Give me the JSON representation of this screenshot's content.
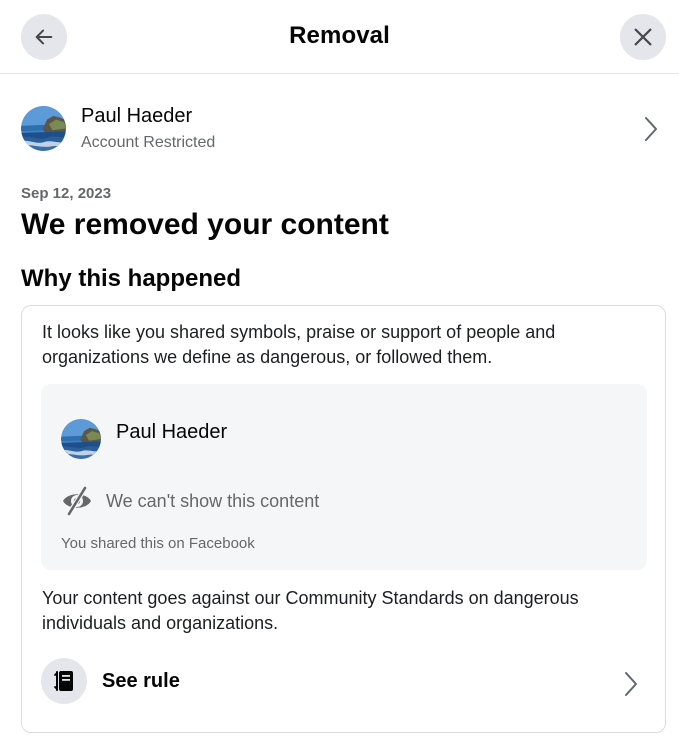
{
  "header": {
    "title": "Removal",
    "back_icon": "arrow-left-icon",
    "close_icon": "close-icon"
  },
  "profile": {
    "name": "Paul Haeder",
    "status": "Account Restricted"
  },
  "notice": {
    "date": "Sep 12, 2023",
    "title": "We removed your content",
    "subtitle": "Why this happened"
  },
  "card": {
    "explanation": "It looks like you shared symbols, praise or support of people and organizations we define as dangerous, or followed them.",
    "preview": {
      "author": "Paul Haeder",
      "hidden_text": "We can't show this content",
      "hidden_icon": "eye-slash-icon",
      "shared_note": "You shared this on Facebook"
    },
    "standards_text": "Your content goes against our Community Standards on dangerous individuals and organizations.",
    "rule": {
      "label": "See rule",
      "icon": "rulebook-icon"
    }
  },
  "colors": {
    "button_bg": "#e4e6eb",
    "secondary_text": "#65676b",
    "preview_bg": "#f5f6f7",
    "border": "#dadde1"
  }
}
